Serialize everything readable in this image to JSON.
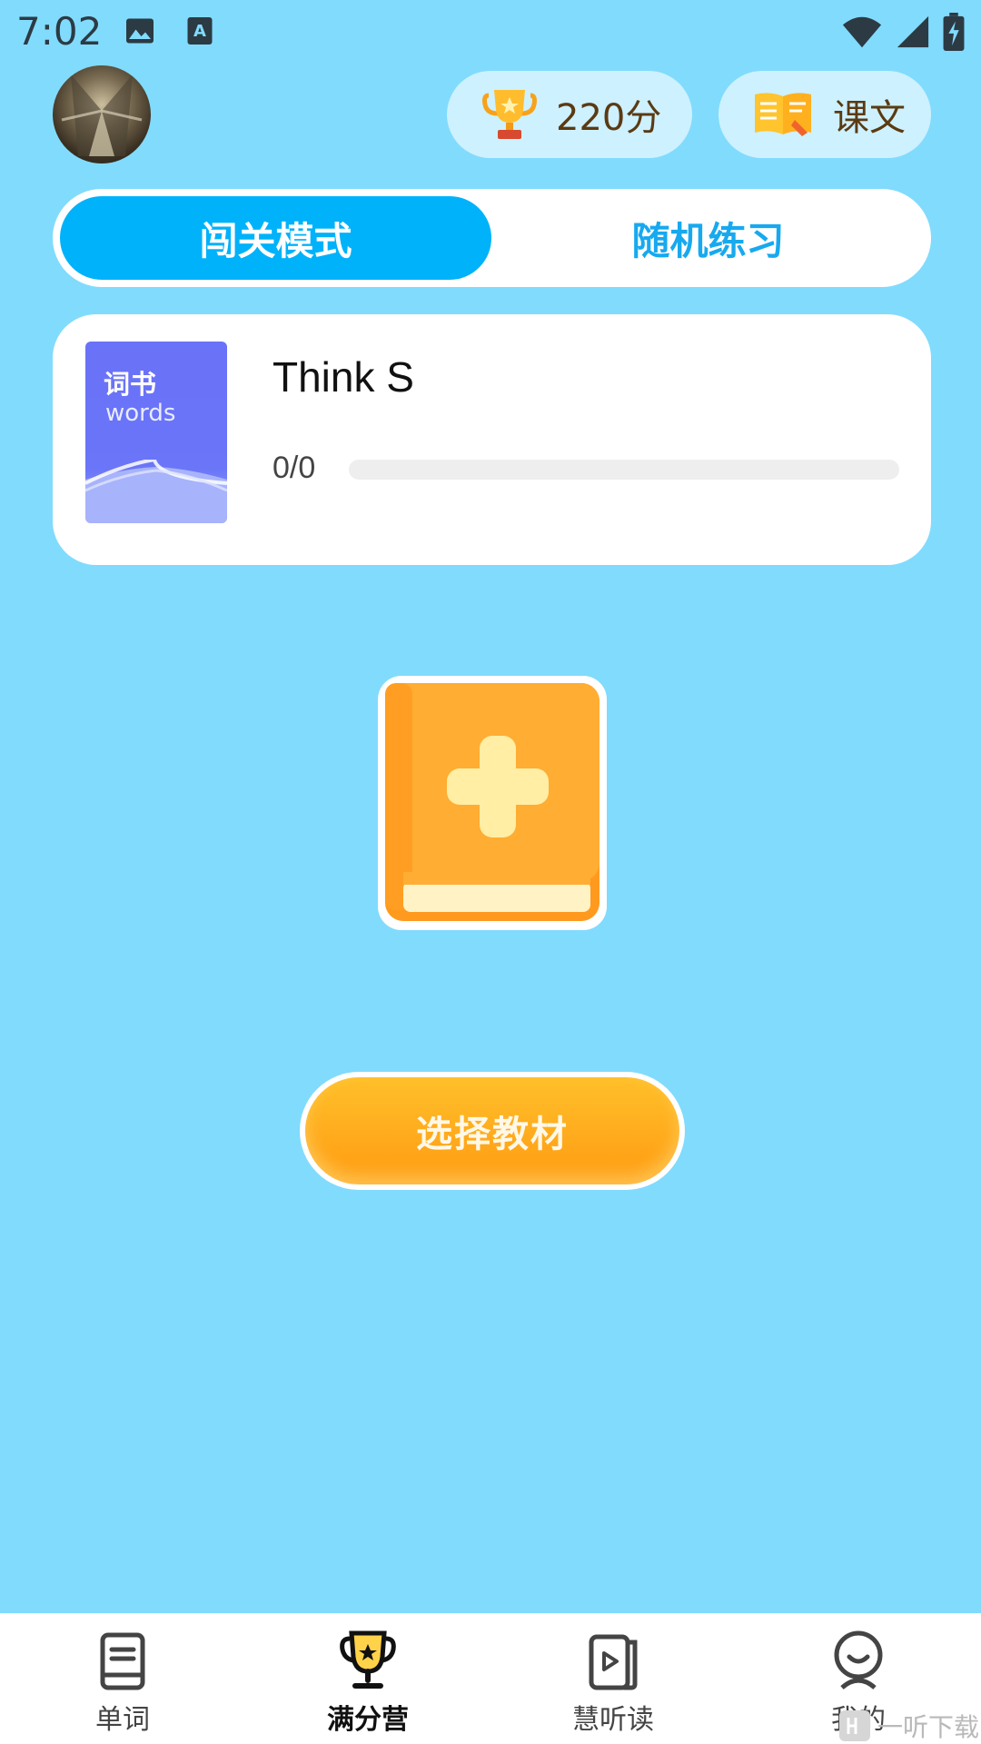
{
  "status_bar": {
    "time": "7:02"
  },
  "header": {
    "score_label": "220分",
    "text_label": "课文"
  },
  "mode_switch": {
    "tabs": [
      {
        "label": "闯关模式",
        "active": true
      },
      {
        "label": "随机练习",
        "active": false
      }
    ]
  },
  "book_card": {
    "cover_zh": "词书",
    "cover_en": "words",
    "title": "Think S",
    "progress_text": "0/0",
    "progress_fraction": 0
  },
  "select_button": {
    "label": "选择教材"
  },
  "bottom_nav": {
    "items": [
      {
        "label": "单词",
        "icon": "book-icon",
        "active": false
      },
      {
        "label": "满分营",
        "icon": "trophy-icon",
        "active": true
      },
      {
        "label": "慧听读",
        "icon": "play-book-icon",
        "active": false
      },
      {
        "label": "我的",
        "icon": "user-icon",
        "active": false
      }
    ]
  },
  "watermark": {
    "text": "一听下载"
  },
  "colors": {
    "background": "#81dbfd",
    "accent": "#00b2fa",
    "button_orange": "#ffab1d"
  }
}
